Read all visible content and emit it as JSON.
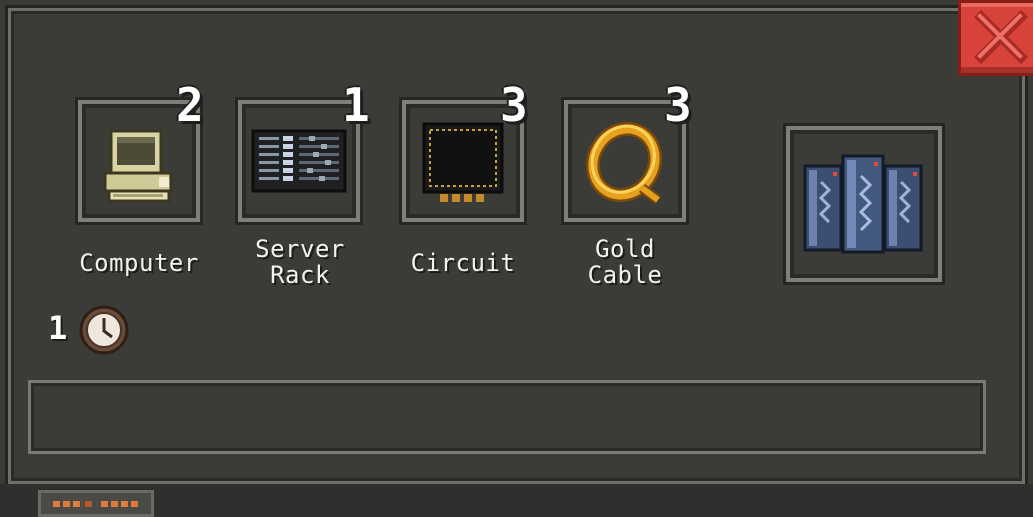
{
  "window": {
    "close_icon": "close-x-icon",
    "accent": "#d8443c"
  },
  "ingredients": [
    {
      "name": "Computer",
      "count": "2",
      "icon": "computer-icon"
    },
    {
      "name": "Server\nRack",
      "count": "1",
      "icon": "server-rack-icon"
    },
    {
      "name": "Circuit",
      "count": "3",
      "icon": "circuit-chip-icon"
    },
    {
      "name": "Gold\nCable",
      "count": "3",
      "icon": "gold-cable-icon"
    }
  ],
  "result": {
    "icon": "server-tower-icon"
  },
  "craft_time": {
    "value": "1",
    "icon": "clock-icon"
  },
  "description": {
    "text": ""
  }
}
